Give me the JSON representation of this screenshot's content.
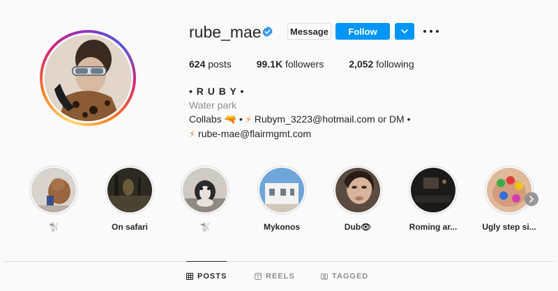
{
  "profile": {
    "username": "rube_mae",
    "verified_icon": "verified-badge-icon",
    "message_label": "Message",
    "follow_label": "Follow",
    "dropdown_icon": "chevron-down-icon",
    "more_icon": "more-options-icon"
  },
  "stats": {
    "posts_count": "624",
    "posts_label": "posts",
    "followers_count": "99.1K",
    "followers_label": "followers",
    "following_count": "2,052",
    "following_label": "following"
  },
  "bio": {
    "name": "• R U B Y •",
    "category": "Water park",
    "line1_prefix": "Collabs",
    "line1_mid": "•",
    "line1_contact": "Rubym_3223@hotmail.com or DM •",
    "line2_contact": "rube-mae@flairmgmt.com",
    "emoji_gun": "🔫",
    "emoji_bolt": "⚡"
  },
  "highlights": [
    {
      "label": "🐩"
    },
    {
      "label": "On safari"
    },
    {
      "label": "🐩"
    },
    {
      "label": "Mykonos"
    },
    {
      "label": "Dub👁"
    },
    {
      "label": "Roming ar..."
    },
    {
      "label": "Ugly step si..."
    }
  ],
  "tabs": [
    {
      "label": "POSTS",
      "icon": "grid-icon"
    },
    {
      "label": "REELS",
      "icon": "reels-icon"
    },
    {
      "label": "TAGGED",
      "icon": "tagged-icon"
    }
  ],
  "colors": {
    "accent": "#0095f6",
    "text": "#262626",
    "muted": "#8e8e8e",
    "border": "#dbdbdb",
    "background": "#fafafa"
  }
}
